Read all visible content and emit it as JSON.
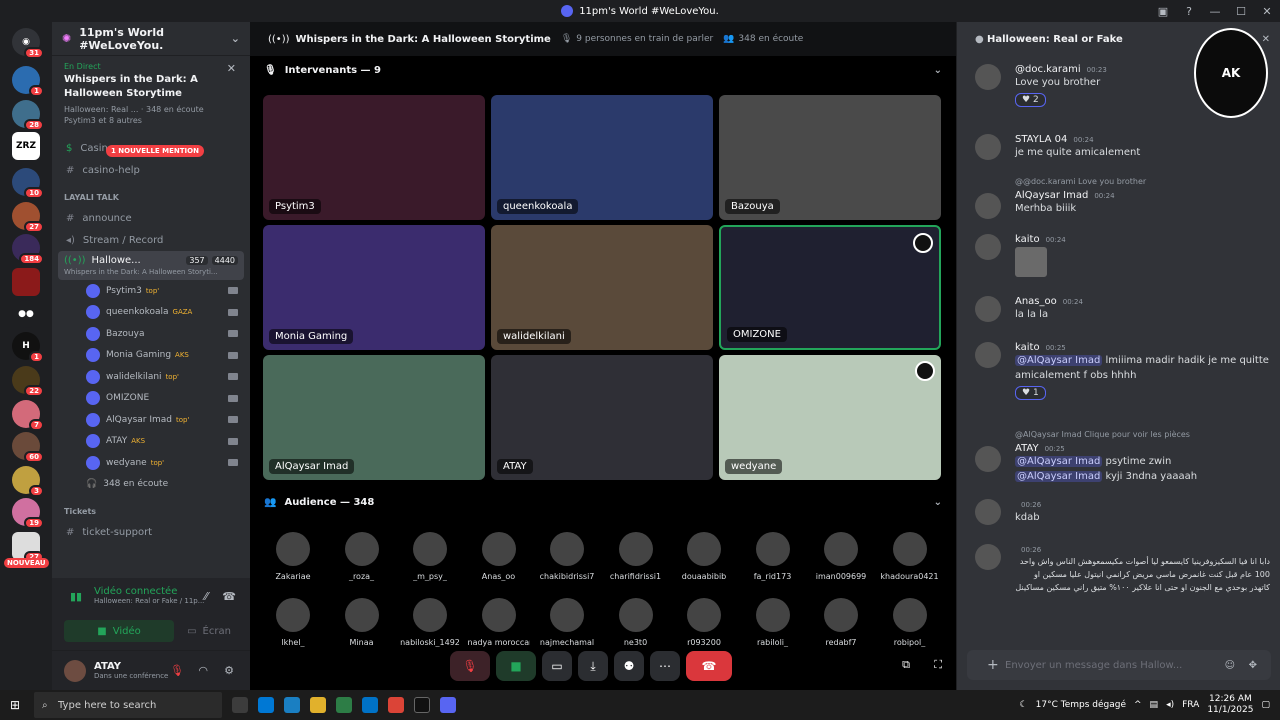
{
  "window": {
    "title": "11pm's World #WeLoveYou."
  },
  "server": {
    "name": "11pm's World #WeLoveYou."
  },
  "rail": {
    "badges": [
      "31",
      "1",
      "28",
      "",
      "10",
      "27",
      "184",
      "",
      "",
      "1",
      "22",
      "7",
      "60",
      "3",
      "19",
      "27"
    ],
    "labels": {
      "zrz": "ZRZ",
      "nouveau": "NOUVEAU"
    }
  },
  "live_card": {
    "status": "En Direct",
    "title": "Whispers in the Dark: A Halloween Storytime",
    "sub": "Halloween: Real ... · 348 en écoute",
    "sub2": "Psytim3 et 8 autres"
  },
  "channels": {
    "casino": "Casin",
    "mention": "1 NOUVELLE MENTION",
    "casino_help": "casino-help",
    "cat_layali": "LAYALI TALK",
    "announce": "announce",
    "stream_record": "Stream / Record",
    "active_voice": "Hallowe...",
    "active_count1": "357",
    "active_count2": "4440",
    "active_sub": "Whispers in the Dark: A Halloween Storyti...",
    "listening": "348 en écoute",
    "cat_tickets": "Tickets",
    "ticket_support": "ticket-support"
  },
  "members": [
    {
      "name": "Psytim3",
      "tag": "top'"
    },
    {
      "name": "queenkokoala",
      "tag": "GAZA"
    },
    {
      "name": "Bazouya",
      "tag": ""
    },
    {
      "name": "Monia Gaming",
      "tag": "AKS"
    },
    {
      "name": "walidelkilani",
      "tag": "top'"
    },
    {
      "name": "OMIZONE",
      "tag": ""
    },
    {
      "name": "AlQaysar Imad",
      "tag": "top'"
    },
    {
      "name": "ATAY",
      "tag": "AKS"
    },
    {
      "name": "wedyane",
      "tag": "top'"
    }
  ],
  "voice_conn": {
    "status": "Vidéo connectée",
    "channel": "Halloween: Real or Fake / 11p...",
    "video": "Vidéo",
    "screen": "Écran"
  },
  "user": {
    "name": "ATAY",
    "status": "Dans une conférence"
  },
  "stage": {
    "title": "Whispers in the Dark: A Halloween Storytime",
    "speaking": "9 personnes en train de parler",
    "listening": "348 en écoute",
    "speakers_label": "Intervenants — 9",
    "audience_label": "Audience — 348"
  },
  "tiles": [
    {
      "name": "Psytim3",
      "color": "#3a1a2a"
    },
    {
      "name": "queenkokoala",
      "color": "#2b3a6b"
    },
    {
      "name": "Bazouya",
      "color": "#4a4a4a"
    },
    {
      "name": "Monia Gaming",
      "color": "#3b2c6e"
    },
    {
      "name": "walidelkilani",
      "color": "#5a4a3a"
    },
    {
      "name": "OMIZONE",
      "color": "#1f2030"
    },
    {
      "name": "AlQaysar Imad",
      "color": "#4a6a5a"
    },
    {
      "name": "ATAY",
      "color": "#2f2f36"
    },
    {
      "name": "wedyane",
      "color": "#b8c9b8"
    }
  ],
  "audience": [
    "Zakariae",
    "_roza_",
    "_m_psy_",
    "Anas_oo",
    "chakibidrissi7",
    "charifidrissi1",
    "douaabibib",
    "fa_rid173",
    "iman009699",
    "khadoura0421",
    "lkhel_",
    "Minaa",
    "nabiloski_1492",
    "nadya moroccan",
    "najmechamal",
    "ne3t0",
    "r093200",
    "rabiloli_",
    "redabf7",
    "robipol_"
  ],
  "chat": {
    "title": "Halloween: Real or Fake",
    "input_placeholder": "Envoyer un message dans  Hallow...",
    "messages": [
      {
        "user": "@doc.karami",
        "time": "00:23",
        "text": "Love you brother",
        "reaction": "2"
      },
      {
        "user": "STAYLA 04",
        "time": "00:24",
        "text": "je me quite amicalement"
      },
      {
        "reply": "@@doc.karami Love you brother",
        "user": "AlQaysar Imad",
        "time": "00:24",
        "text": "Merhba biiik"
      },
      {
        "user": "kaito",
        "time": "00:24",
        "text": ""
      },
      {
        "user": "Anas_oo",
        "time": "00:24",
        "text": "la la la"
      },
      {
        "user": "kaito",
        "time": "00:25",
        "mention": "@AlQaysar Imad",
        "text": "lmiiima madir hadik je me quitte amicalement f obs hhhh",
        "reaction": "1"
      },
      {
        "reply": "@AlQaysar Imad Clique pour voir les pièces",
        "user": "ATAY",
        "time": "00:25",
        "text": "psytime zwin",
        "mention": "@AlQaysar Imad",
        "text2": "kyji 3ndna yaaaah"
      },
      {
        "user": "",
        "time": "00:26",
        "text": "kdab"
      },
      {
        "user": "",
        "time": "00:26",
        "text": "دابا انا فيا السكيزوفرينيا كايسمعو ليا أصوات مكيسمعوهش الناس واش واحد 100 عام قبل كنت غانمرض ماسي مريض كرانمي انيتول عليا مسكين او كاتهدر بوحدي مع الجنون او حتى انا علاكير ١٠٠% متيق راني مسكين مساكينل"
      }
    ]
  },
  "taskbar": {
    "search": "Type here to search",
    "weather": "17°C  Temps dégagé",
    "lang": "FRA",
    "time": "12:26 AM",
    "date": "11/1/2025"
  }
}
